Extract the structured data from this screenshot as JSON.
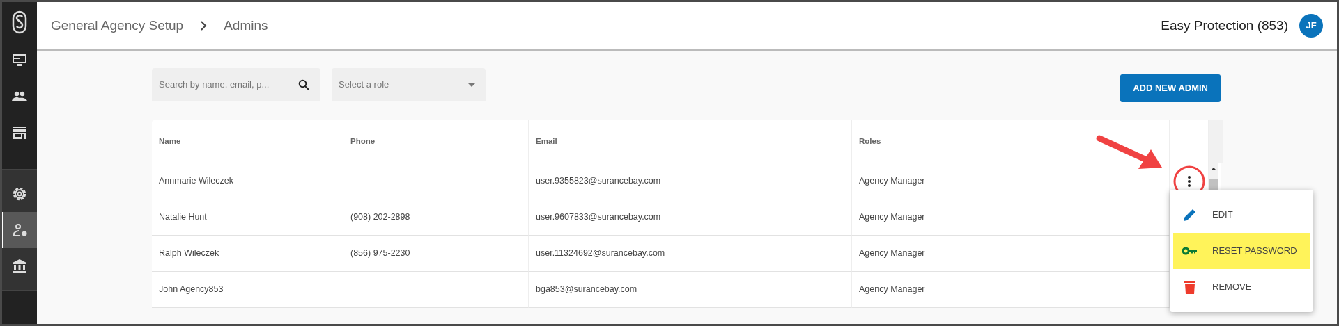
{
  "sidebar": {
    "items": [
      {
        "selected": false
      },
      {
        "selected": false
      },
      {
        "selected": false
      },
      {
        "selected": false
      },
      {
        "selected": true
      },
      {
        "selected": false
      }
    ]
  },
  "breadcrumb": [
    "General Agency Setup",
    "Admins"
  ],
  "agency": "Easy Protection (853)",
  "avatar": "JF",
  "search": {
    "placeholder": "Search by name, email, p..."
  },
  "role_select": {
    "placeholder": "Select a role"
  },
  "add_button": "ADD NEW ADMIN",
  "table": {
    "columns": [
      "Name",
      "Phone",
      "Email",
      "Roles"
    ],
    "rows": [
      {
        "cells": [
          "Annmarie Wileczek",
          "",
          "user.9355823@surancebay.com",
          "Agency Manager"
        ]
      },
      {
        "cells": [
          "Natalie Hunt",
          "(908) 202-2898",
          "user.9607833@surancebay.com",
          "Agency Manager"
        ]
      },
      {
        "cells": [
          "Ralph Wileczek",
          "(856) 975-2230",
          "user.11324692@surancebay.com",
          "Agency Manager"
        ]
      },
      {
        "cells": [
          "John Agency853",
          "",
          "bga853@surancebay.com",
          "Agency Manager"
        ]
      }
    ]
  },
  "row_menu": {
    "items": [
      {
        "kind": "edit",
        "label": "EDIT",
        "highlighted": false
      },
      {
        "kind": "reset",
        "label": "RESET PASSWORD",
        "highlighted": true
      },
      {
        "kind": "remove",
        "label": "REMOVE",
        "highlighted": false
      }
    ]
  }
}
